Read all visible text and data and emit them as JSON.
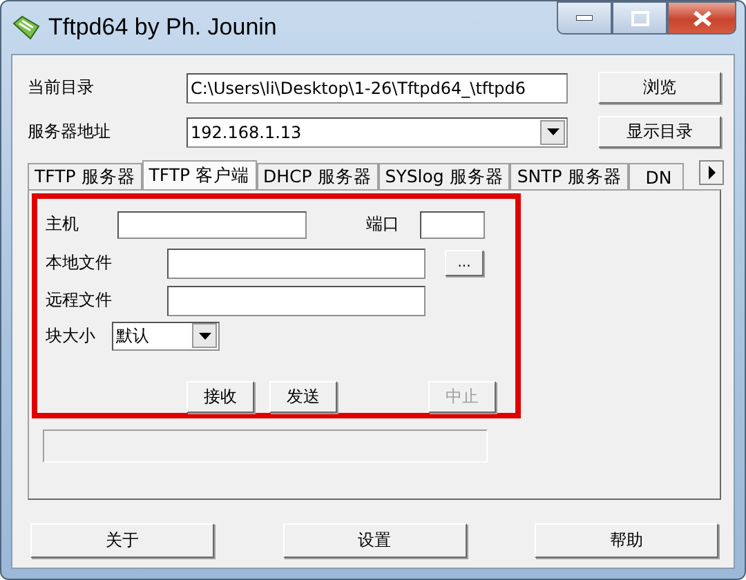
{
  "window": {
    "title": "Tftpd64 by Ph. Jounin"
  },
  "fields": [
    {
      "label": "当前目录",
      "value": "C:\\Users\\li\\Desktop\\1-26\\Tftpd64_\\tftpd6",
      "kind": "text",
      "button": "浏览"
    },
    {
      "label": "服务器地址",
      "value": "192.168.1.13",
      "kind": "combo",
      "button": "显示目录"
    }
  ],
  "tabs": [
    {
      "label": "TFTP 服务器",
      "selected": false
    },
    {
      "label": "TFTP 客户端",
      "selected": true
    },
    {
      "label": "DHCP 服务器",
      "selected": false
    },
    {
      "label": "SYSlog 服务器",
      "selected": false
    },
    {
      "label": "SNTP 服务器",
      "selected": false
    },
    {
      "label": "DN",
      "selected": false
    }
  ],
  "client": {
    "host_label": "主机",
    "port_label": "端口",
    "local_file_label": "本地文件",
    "browse_button": "...",
    "remote_file_label": "远程文件",
    "block_size_label": "块大小",
    "block_size": "默认",
    "buttons": [
      {
        "label": "接收",
        "disabled": false
      },
      {
        "label": "发送",
        "disabled": false
      },
      {
        "label": "中止",
        "disabled": true
      }
    ]
  },
  "footer_buttons": [
    "关于",
    "设置",
    "帮助"
  ]
}
